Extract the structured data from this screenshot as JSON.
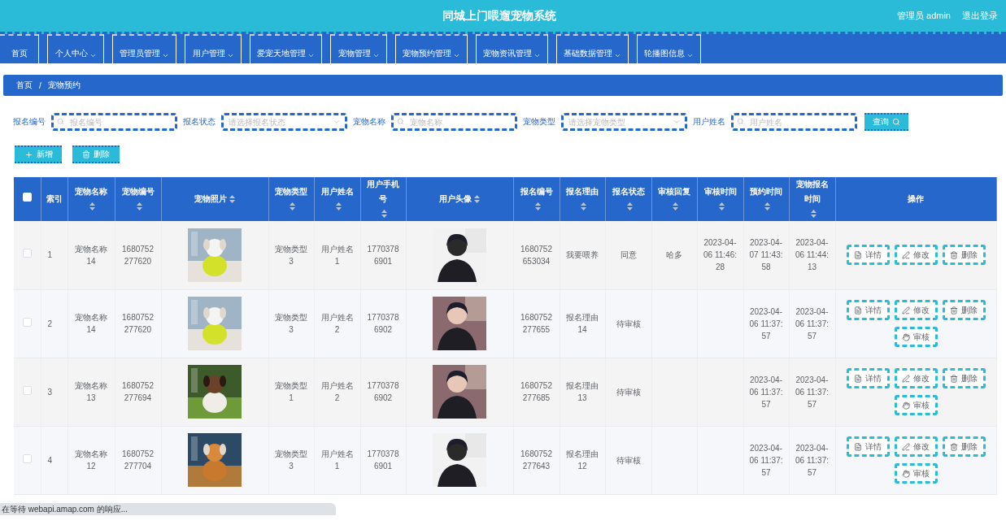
{
  "header": {
    "title": "同城上门喂遛宠物系统",
    "user": "管理员 admin",
    "logout": "退出登录"
  },
  "nav": [
    {
      "label": "首页",
      "dropdown": false
    },
    {
      "label": "个人中心",
      "dropdown": true
    },
    {
      "label": "管理员管理",
      "dropdown": true
    },
    {
      "label": "用户管理",
      "dropdown": true
    },
    {
      "label": "爱宠天地管理",
      "dropdown": true
    },
    {
      "label": "宠物管理",
      "dropdown": true
    },
    {
      "label": "宠物预约管理",
      "dropdown": true
    },
    {
      "label": "宠物资讯管理",
      "dropdown": true
    },
    {
      "label": "基础数据管理",
      "dropdown": true
    },
    {
      "label": "轮播图信息",
      "dropdown": true
    }
  ],
  "breadcrumb": [
    "首页",
    "宠物预约"
  ],
  "breadcrumb_separator": "/",
  "filters": [
    {
      "kind": "input",
      "label": "报名编号",
      "placeholder": "报名编号"
    },
    {
      "kind": "select",
      "label": "报名状态",
      "placeholder": "请选择报名状态"
    },
    {
      "kind": "input",
      "label": "宠物名称",
      "placeholder": "宠物名称"
    },
    {
      "kind": "select",
      "label": "宠物类型",
      "placeholder": "请选择宠物类型"
    },
    {
      "kind": "input",
      "label": "用户姓名",
      "placeholder": "用户姓名"
    }
  ],
  "search_button": "查询",
  "toolbar": [
    {
      "kind": "add",
      "label": "新增"
    },
    {
      "kind": "delete",
      "label": "删除"
    }
  ],
  "table": {
    "select_all_checked": false,
    "columns": [
      {
        "label": "索引",
        "sortable": false
      },
      {
        "label": "宠物名称",
        "sortable": true
      },
      {
        "label": "宠物编号",
        "sortable": true
      },
      {
        "label": "宠物照片",
        "sortable": true
      },
      {
        "label": "宠物类型",
        "sortable": true
      },
      {
        "label": "用户姓名",
        "sortable": true
      },
      {
        "label": "用户手机号",
        "sortable": true
      },
      {
        "label": "用户头像",
        "sortable": true
      },
      {
        "label": "报名编号",
        "sortable": true
      },
      {
        "label": "报名理由",
        "sortable": true
      },
      {
        "label": "报名状态",
        "sortable": true
      },
      {
        "label": "审核回复",
        "sortable": true
      },
      {
        "label": "审核时间",
        "sortable": true
      },
      {
        "label": "预约时间",
        "sortable": true
      },
      {
        "label": "宠物报名时间",
        "sortable": true
      },
      {
        "label": "操作",
        "sortable": false
      }
    ],
    "rows": [
      {
        "checked": false,
        "index": "1",
        "pet_name": "宠物名称14",
        "pet_no": "1680752277620",
        "pet_photo": {
          "kind": "picture"
        },
        "pet_type": "宠物类型3",
        "user_name": "用户姓名1",
        "phone": "17703786901",
        "avatar": {
          "kind": "picture"
        },
        "apply_no": "1680752653034",
        "reason": "我要喂养",
        "status": "同意",
        "reply": "哈多",
        "review_time": "2023-04-06 11:46:28",
        "booking_time": "2023-04-07 11:43:58",
        "apply_time": "2023-04-06 11:44:13",
        "actions": [
          {
            "kind": "detail",
            "label": "详情"
          },
          {
            "kind": "edit",
            "label": "修改"
          },
          {
            "kind": "delete",
            "label": "删除"
          }
        ]
      },
      {
        "checked": false,
        "index": "2",
        "pet_name": "宠物名称14",
        "pet_no": "1680752277620",
        "pet_photo": {
          "kind": "picture"
        },
        "pet_type": "宠物类型3",
        "user_name": "用户姓名2",
        "phone": "17703786902",
        "avatar": {
          "kind": "picture"
        },
        "apply_no": "1680752277655",
        "reason": "报名理由14",
        "status": "待审核",
        "booking_time": "2023-04-06 11:37:57",
        "apply_time": "2023-04-06 11:37:57",
        "actions": [
          {
            "kind": "detail",
            "label": "详情"
          },
          {
            "kind": "edit",
            "label": "修改"
          },
          {
            "kind": "delete",
            "label": "删除"
          },
          {
            "kind": "audit",
            "label": "审核"
          }
        ]
      },
      {
        "checked": false,
        "index": "3",
        "pet_name": "宠物名称13",
        "pet_no": "1680752277694",
        "pet_photo": {
          "kind": "picture"
        },
        "pet_type": "宠物类型1",
        "user_name": "用户姓名2",
        "phone": "17703786902",
        "avatar": {
          "kind": "picture"
        },
        "apply_no": "1680752277685",
        "reason": "报名理由13",
        "status": "待审核",
        "booking_time": "2023-04-06 11:37:57",
        "apply_time": "2023-04-06 11:37:57",
        "actions": [
          {
            "kind": "detail",
            "label": "详情"
          },
          {
            "kind": "edit",
            "label": "修改"
          },
          {
            "kind": "delete",
            "label": "删除"
          },
          {
            "kind": "audit",
            "label": "审核"
          }
        ]
      },
      {
        "checked": false,
        "index": "4",
        "pet_name": "宠物名称12",
        "pet_no": "1680752277704",
        "pet_photo": {
          "kind": "picture"
        },
        "pet_type": "宠物类型3",
        "user_name": "用户姓名1",
        "phone": "17703786901",
        "avatar": {
          "kind": "picture"
        },
        "apply_no": "1680752277643",
        "reason": "报名理由12",
        "status": "待审核",
        "booking_time": "2023-04-06 11:37:57",
        "apply_time": "2023-04-06 11:37:57",
        "actions": [
          {
            "kind": "detail",
            "label": "详情"
          },
          {
            "kind": "edit",
            "label": "修改"
          },
          {
            "kind": "delete",
            "label": "删除"
          },
          {
            "kind": "audit",
            "label": "审核"
          }
        ]
      }
    ]
  },
  "status_bar": "在等待 webapi.amap.com 的响应..."
}
